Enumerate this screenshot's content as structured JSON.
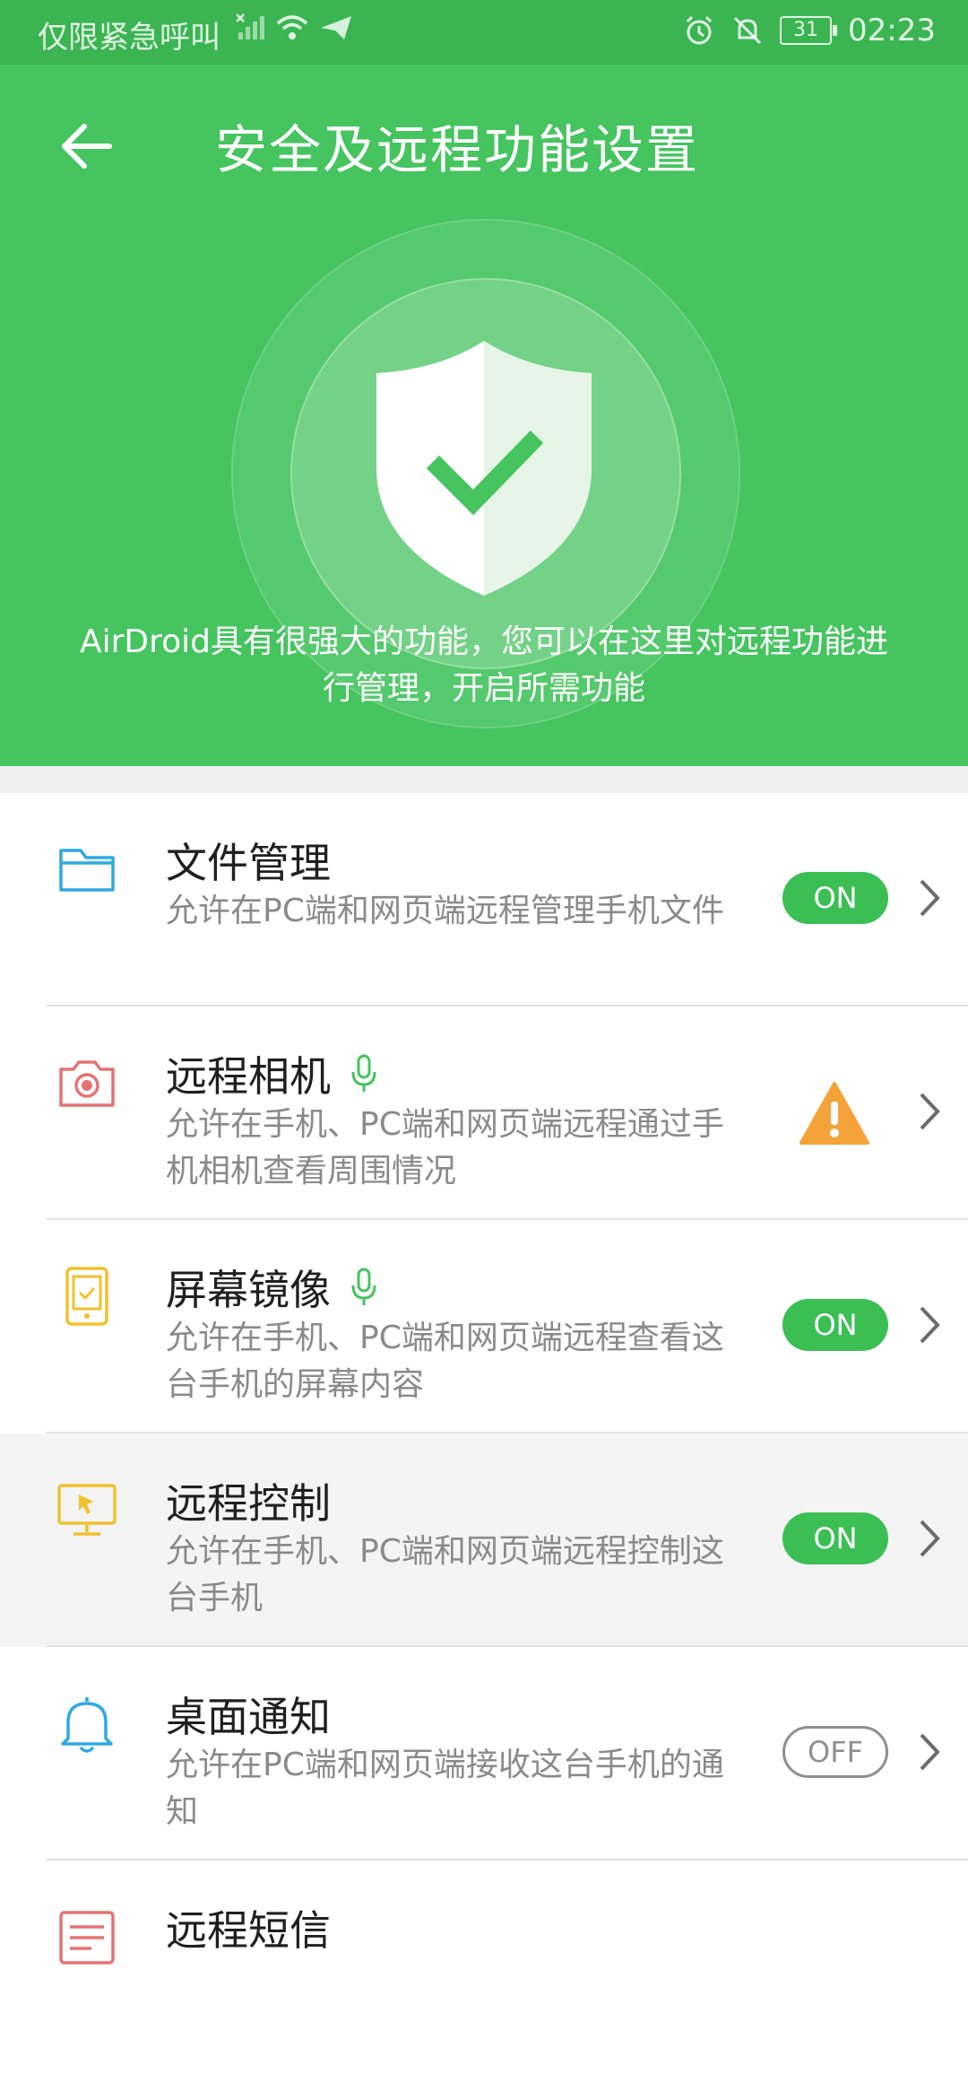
{
  "status_bar": {
    "carrier_text": "仅限紧急呼叫",
    "battery": "31",
    "time": "02:23",
    "icons": [
      "no-signal-icon",
      "wifi-icon",
      "send-icon",
      "alarm-icon",
      "mute-bell-icon",
      "battery-icon"
    ]
  },
  "header": {
    "title": "安全及远程功能设置",
    "description": "AirDroid具有很强大的功能，您可以在这里对远程功能进行管理，开启所需功能",
    "colors": {
      "background": "#45c45f",
      "statusbar": "#3bb552"
    }
  },
  "features": [
    {
      "title": "文件管理",
      "desc": "允许在PC端和网页端远程管理手机文件",
      "status": "ON",
      "icon": "folder-icon"
    },
    {
      "title": "远程相机",
      "desc": "允许在手机、PC端和网页端远程通过手机相机查看周围情况",
      "status": "warning",
      "icon": "camera-icon",
      "mic": true
    },
    {
      "title": "屏幕镜像",
      "desc": "允许在手机、PC端和网页端远程查看这台手机的屏幕内容",
      "status": "ON",
      "icon": "phone-mirror-icon",
      "mic": true
    },
    {
      "title": "远程控制",
      "desc": "允许在手机、PC端和网页端远程控制这台手机",
      "status": "ON",
      "icon": "monitor-cursor-icon"
    },
    {
      "title": "桌面通知",
      "desc": "允许在PC端和网页端接收这台手机的通知",
      "status": "OFF",
      "icon": "bell-icon"
    },
    {
      "title": "远程短信",
      "icon": "sms-icon"
    }
  ]
}
